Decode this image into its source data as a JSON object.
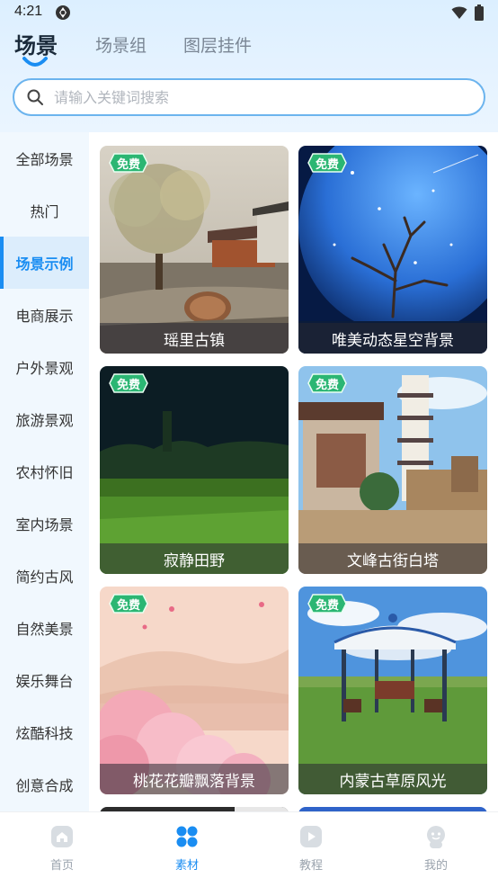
{
  "status_bar": {
    "time": "4:21"
  },
  "tabs": [
    {
      "label": "场景",
      "active": true
    },
    {
      "label": "场景组",
      "active": false
    },
    {
      "label": "图层挂件",
      "active": false
    }
  ],
  "search": {
    "placeholder": "请输入关键词搜索",
    "value": ""
  },
  "sidebar": {
    "items": [
      {
        "label": "全部场景"
      },
      {
        "label": "热门"
      },
      {
        "label": "场景示例",
        "active": true
      },
      {
        "label": "电商展示"
      },
      {
        "label": "户外景观"
      },
      {
        "label": "旅游景观"
      },
      {
        "label": "农村怀旧"
      },
      {
        "label": "室内场景"
      },
      {
        "label": "简约古风"
      },
      {
        "label": "自然美景"
      },
      {
        "label": "娱乐舞台"
      },
      {
        "label": "炫酷科技"
      },
      {
        "label": "创意合成"
      }
    ]
  },
  "cards": [
    {
      "title": "瑶里古镇",
      "badge": "免费"
    },
    {
      "title": "唯美动态星空背景",
      "badge": "免费"
    },
    {
      "title": "寂静田野",
      "badge": "免费"
    },
    {
      "title": "文峰古街白塔",
      "badge": "免费"
    },
    {
      "title": "桃花花瓣飘落背景",
      "badge": "免费"
    },
    {
      "title": "内蒙古草原风光",
      "badge": "免费"
    }
  ],
  "bottom_nav": [
    {
      "label": "首页",
      "icon": "home-icon"
    },
    {
      "label": "素材",
      "icon": "material-icon",
      "active": true
    },
    {
      "label": "教程",
      "icon": "tutorial-icon"
    },
    {
      "label": "我的",
      "icon": "profile-icon"
    }
  ],
  "colors": {
    "accent": "#1a8df2",
    "badge_green": "#2bb673",
    "sidebar_bg": "#f1f8fe",
    "search_border": "#6cb4ee"
  }
}
